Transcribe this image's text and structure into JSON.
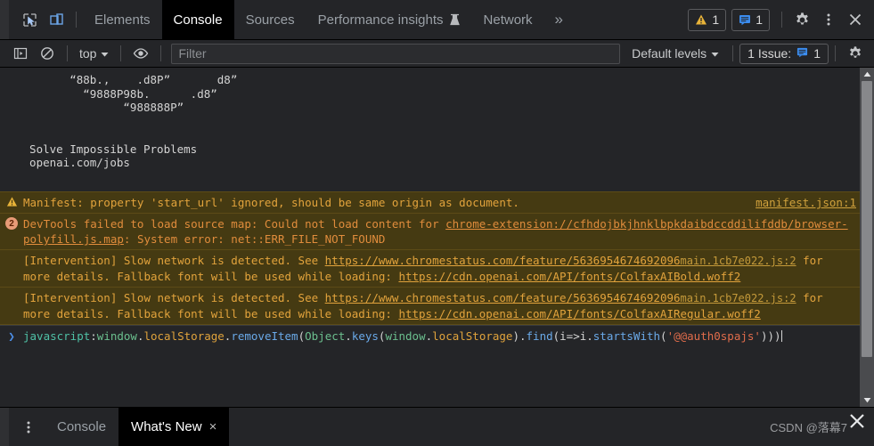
{
  "topbar": {
    "inspect_icon": "inspect-cursor-icon",
    "device_icon": "device-toolbar-icon",
    "tabs": [
      {
        "label": "Elements",
        "active": false
      },
      {
        "label": "Console",
        "active": true
      },
      {
        "label": "Sources",
        "active": false
      },
      {
        "label": "Performance insights",
        "active": false,
        "beaker": true
      },
      {
        "label": "Network",
        "active": false
      }
    ],
    "more_label": "»",
    "warning_count": "1",
    "message_count": "1",
    "settings_icon": "gear-icon",
    "kebab_icon": "more-vertical-icon",
    "close_icon": "close-icon"
  },
  "console_toolbar": {
    "sidebar_toggle_icon": "console-sidebar-icon",
    "clear_icon": "clear-console-icon",
    "context_label": "top",
    "eye_icon": "live-expression-icon",
    "filter_placeholder": "Filter",
    "filter_value": "",
    "levels_label": "Default levels",
    "issues_label": "1 Issue:",
    "issues_count": "1",
    "settings_icon": "console-settings-gear-icon"
  },
  "console": {
    "ascii_art": "        “88b.,    .d8P”       d8”\n          “9888P98b.      .d8”\n                “988888P”\n\n\n  Solve Impossible Problems\n  openai.com/jobs",
    "messages": [
      {
        "type": "warning",
        "icon": "warning-triangle-icon",
        "text": "Manifest: property 'start_url' ignored, should be same origin as document.",
        "source": "manifest.json:1"
      },
      {
        "type": "error",
        "icon": "error-count-badge",
        "badge": "2",
        "prefix": "DevTools failed to load source map: Could not load content for ",
        "link": "chrome-extension://cfhdojbkjhnklbpkdaibdccddilifddb/browser-polyfill.js.map",
        "suffix": ": System error: net::ERR_FILE_NOT_FOUND"
      },
      {
        "type": "warning",
        "prefix": "[Intervention] Slow network is detected. See ",
        "link1": "https://www.chromestatus.com/feature/5636954674692096",
        "middle": " for more details. Fallback font will be used while loading: ",
        "link2": "https://cdn.openai.com/API/fonts/ColfaxAIBold.woff2",
        "source": "main.1cb7e022.js:2"
      },
      {
        "type": "warning",
        "prefix": "[Intervention] Slow network is detected. See ",
        "link1": "https://www.chromestatus.com/feature/5636954674692096",
        "middle": " for more details. Fallback font will be used while loading: ",
        "link2": "https://cdn.openai.com/API/fonts/ColfaxAIRegular.woff2",
        "source": "main.1cb7e022.js:2"
      }
    ],
    "prompt": {
      "arrow": "❯",
      "tokens": [
        {
          "t": "javascript",
          "c": "kw"
        },
        {
          "t": ":",
          "c": "plain"
        },
        {
          "t": "window",
          "c": "glob"
        },
        {
          "t": ".",
          "c": "plain"
        },
        {
          "t": "localStorage",
          "c": "prop"
        },
        {
          "t": ".",
          "c": "plain"
        },
        {
          "t": "removeItem",
          "c": "fn"
        },
        {
          "t": "(",
          "c": "plain"
        },
        {
          "t": "Object",
          "c": "glob"
        },
        {
          "t": ".",
          "c": "plain"
        },
        {
          "t": "keys",
          "c": "fn"
        },
        {
          "t": "(",
          "c": "plain"
        },
        {
          "t": "window",
          "c": "glob"
        },
        {
          "t": ".",
          "c": "plain"
        },
        {
          "t": "localStorage",
          "c": "prop"
        },
        {
          "t": ").",
          "c": "plain"
        },
        {
          "t": "find",
          "c": "fn"
        },
        {
          "t": "(i=>i.",
          "c": "plain"
        },
        {
          "t": "startsWith",
          "c": "fn"
        },
        {
          "t": "(",
          "c": "plain"
        },
        {
          "t": "'@@auth0spajs'",
          "c": "str"
        },
        {
          "t": ")))",
          "c": "plain"
        }
      ]
    }
  },
  "drawer": {
    "menu_icon": "more-vertical-icon",
    "tabs": [
      {
        "label": "Console",
        "active": false,
        "closable": false
      },
      {
        "label": "What's New",
        "active": true,
        "closable": true
      }
    ],
    "close_glyph": "×",
    "watermark": "CSDN @落幕7",
    "watermark_close": "✕"
  },
  "colors": {
    "background": "#242528",
    "warning_bg": "#453a12",
    "warning_text": "#e2a33c",
    "error_text": "#e08c3c",
    "accent_blue": "#4d8fe8",
    "active_tab_bg": "#000000"
  }
}
